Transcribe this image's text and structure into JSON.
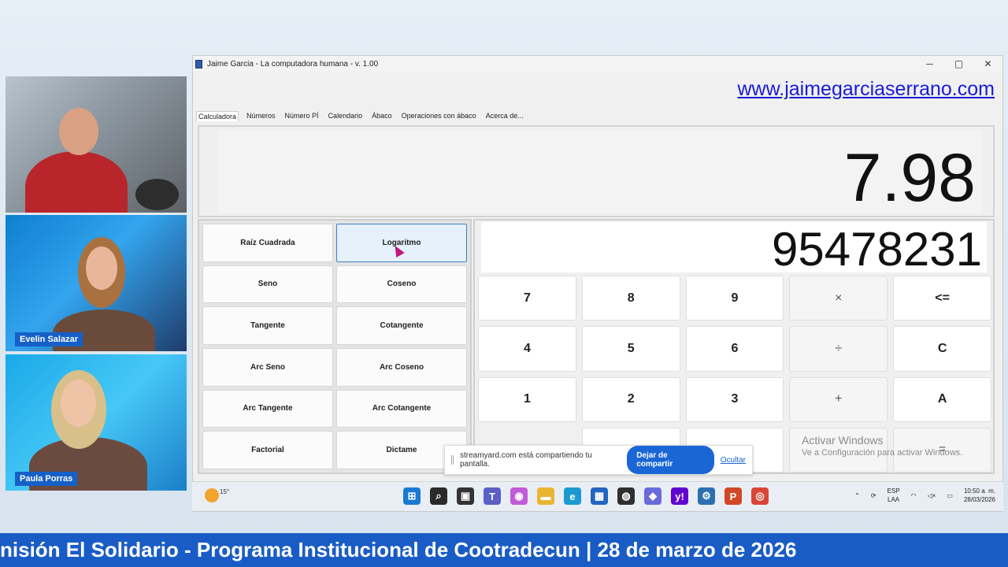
{
  "participants": [
    {
      "name": ""
    },
    {
      "name": "Evelin Salazar"
    },
    {
      "name": "Paula Porras"
    }
  ],
  "window": {
    "title": "Jaime Garcia - La computadora humana - v. 1.00",
    "controls": [
      "─",
      "▢",
      "✕"
    ]
  },
  "site_link": "www.jaimegarciaserrano.com",
  "tabs": [
    "Calculadora",
    "Números",
    "Número PÍ",
    "Calendario",
    "Ábaco",
    "Operaciones con ábaco",
    "Acerca de..."
  ],
  "result": "7.98",
  "input": "95478231",
  "functions": [
    "Raíz Cuadrada",
    "Logaritmo",
    "Seno",
    "Coseno",
    "Tangente",
    "Cotangente",
    "Arc Seno",
    "Arc Coseno",
    "Arc Tangente",
    "Arc Cotangente",
    "Factorial",
    "Dictame"
  ],
  "keys": [
    "7",
    "8",
    "9",
    "×",
    "<=",
    "4",
    "5",
    "6",
    "÷",
    "C",
    "1",
    "2",
    "3",
    "+",
    "A",
    "",
    "",
    "",
    "",
    "="
  ],
  "share_bar": {
    "text": "streamyard.com está compartiendo tu pantalla.",
    "stop": "Dejar de compartir",
    "hide": "Ocultar"
  },
  "watermark": {
    "line1": "Activar Windows",
    "line2": "Ve a Configuración para activar Windows."
  },
  "taskbar": {
    "temperature": "15°",
    "lang_top": "ESP",
    "lang_bottom": "LAA",
    "time": "10:50 a. m.",
    "date": "28/03/2026",
    "icons": [
      {
        "name": "windows-start-icon",
        "glyph": "⊞",
        "color": "#1a78d6"
      },
      {
        "name": "search-icon",
        "glyph": "⌕",
        "color": "#2a2a2a"
      },
      {
        "name": "task-view-icon",
        "glyph": "▣",
        "color": "#333333"
      },
      {
        "name": "teams-icon",
        "glyph": "T",
        "color": "#5b5fc7"
      },
      {
        "name": "copilot-icon",
        "glyph": "◉",
        "color": "#c25bd6"
      },
      {
        "name": "file-explorer-icon",
        "glyph": "▬",
        "color": "#e8b530"
      },
      {
        "name": "edge-icon",
        "glyph": "e",
        "color": "#1b9ad1"
      },
      {
        "name": "store-icon",
        "glyph": "▦",
        "color": "#2266c4"
      },
      {
        "name": "obs-icon",
        "glyph": "◍",
        "color": "#303030"
      },
      {
        "name": "app-icon",
        "glyph": "◆",
        "color": "#6a6adb"
      },
      {
        "name": "yahoo-icon",
        "glyph": "y!",
        "color": "#6001d2"
      },
      {
        "name": "calculator-app-icon",
        "glyph": "⚙",
        "color": "#2c6fb0"
      },
      {
        "name": "powerpoint-icon",
        "glyph": "P",
        "color": "#d24726"
      },
      {
        "name": "chrome-icon",
        "glyph": "◎",
        "color": "#db4437"
      }
    ]
  },
  "banner": "nisión El Solidario - Programa Institucional de Cootradecun | 28 de marzo de 2026"
}
